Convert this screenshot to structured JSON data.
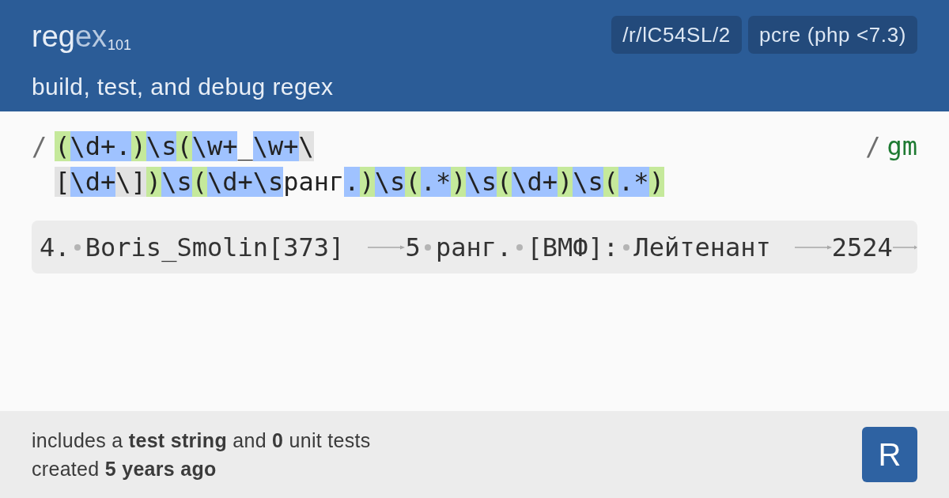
{
  "header": {
    "logo": [
      {
        "text": "reg",
        "kind": "base"
      },
      {
        "text": "ex",
        "kind": "faded"
      },
      {
        "text": "101",
        "kind": "sub"
      }
    ],
    "tagline": "build, test, and debug regex",
    "badges": [
      "/r/lC54SL/2",
      "pcre (php <7.3)"
    ]
  },
  "regex": {
    "delimiter_open": "/",
    "lines": [
      [
        {
          "text": "(",
          "kind": "group"
        },
        {
          "text": "\\d+.",
          "kind": "token"
        },
        {
          "text": ")",
          "kind": "group"
        },
        {
          "text": "\\s",
          "kind": "token"
        },
        {
          "text": "(",
          "kind": "group"
        },
        {
          "text": "\\w+",
          "kind": "token"
        },
        {
          "text": "_",
          "kind": "literal"
        },
        {
          "text": "\\w+",
          "kind": "token"
        },
        {
          "text": "\\",
          "kind": "escape"
        }
      ],
      [
        {
          "text": "[",
          "kind": "escape"
        },
        {
          "text": "\\d+",
          "kind": "token"
        },
        {
          "text": "\\]",
          "kind": "escape"
        },
        {
          "text": ")",
          "kind": "group"
        },
        {
          "text": "\\s",
          "kind": "token"
        },
        {
          "text": "(",
          "kind": "group"
        },
        {
          "text": "\\d+\\s",
          "kind": "token"
        },
        {
          "text": "ранг",
          "kind": "literal"
        },
        {
          "text": ".",
          "kind": "token"
        },
        {
          "text": ")",
          "kind": "group"
        },
        {
          "text": "\\s",
          "kind": "token"
        },
        {
          "text": "(",
          "kind": "group"
        },
        {
          "text": ".*",
          "kind": "token"
        },
        {
          "text": ")",
          "kind": "group"
        },
        {
          "text": "\\s",
          "kind": "token"
        },
        {
          "text": "(",
          "kind": "group"
        },
        {
          "text": "\\d+",
          "kind": "token"
        },
        {
          "text": ")",
          "kind": "group"
        },
        {
          "text": "\\s",
          "kind": "token"
        },
        {
          "text": "(",
          "kind": "group"
        },
        {
          "text": ".*",
          "kind": "token"
        },
        {
          "text": ")",
          "kind": "group"
        }
      ]
    ],
    "delimiter_close": "/",
    "flags": "gm"
  },
  "test_string": {
    "segments": [
      {
        "kind": "text",
        "text": "4."
      },
      {
        "kind": "space"
      },
      {
        "kind": "text",
        "text": "Boris_Smolin[373]"
      },
      {
        "kind": "tab"
      },
      {
        "kind": "text",
        "text": "5"
      },
      {
        "kind": "space"
      },
      {
        "kind": "text",
        "text": "ранг."
      },
      {
        "kind": "space"
      },
      {
        "kind": "text",
        "text": "[ВМФ]:"
      },
      {
        "kind": "space"
      },
      {
        "kind": "text",
        "text": "Лейтенант"
      },
      {
        "kind": "tab"
      },
      {
        "kind": "text",
        "text": "2524"
      },
      {
        "kind": "tab"
      }
    ]
  },
  "footer": {
    "lines": [
      "includes a **test string** and **0** unit tests",
      "created **5 years ago**"
    ],
    "logo": "R"
  }
}
